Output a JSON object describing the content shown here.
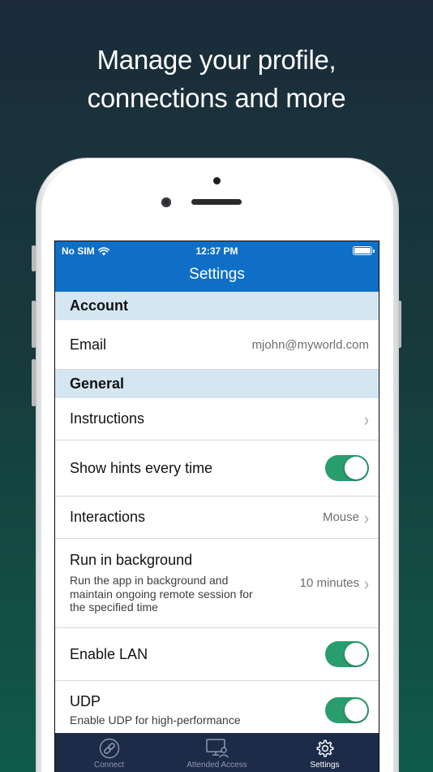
{
  "headline": {
    "line1": "Manage your profile,",
    "line2": "connections and more"
  },
  "status_bar": {
    "carrier": "No SIM",
    "time": "12:37 PM",
    "wifi_icon": "wifi-icon",
    "battery_icon": "battery-icon"
  },
  "nav": {
    "title": "Settings"
  },
  "sections": {
    "account": {
      "header": "Account",
      "email_label": "Email",
      "email_value": "mjohn@myworld.com"
    },
    "general": {
      "header": "General",
      "instructions_label": "Instructions",
      "hints_label": "Show hints every time",
      "hints_on": true,
      "interactions_label": "Interactions",
      "interactions_value": "Mouse",
      "background_label": "Run in background",
      "background_sub": "Run the app in background and maintain ongoing remote session for the specified time",
      "background_value": "10 minutes",
      "lan_label": "Enable LAN",
      "lan_on": true,
      "udp_label": "UDP",
      "udp_sub": "Enable UDP for high-performance",
      "udp_on": true
    }
  },
  "tabbar": {
    "tabs": [
      {
        "label": "Connect",
        "icon": "link-icon",
        "active": false
      },
      {
        "label": "Attended Access",
        "icon": "monitor-person-icon",
        "active": false
      },
      {
        "label": "Settings",
        "icon": "gear-icon",
        "active": true
      }
    ]
  },
  "colors": {
    "nav_blue": "#0f6fc6",
    "section_header": "#d4e6f1",
    "toggle_green": "#2a9d6e",
    "tabbar_bg": "#1c2b48"
  }
}
